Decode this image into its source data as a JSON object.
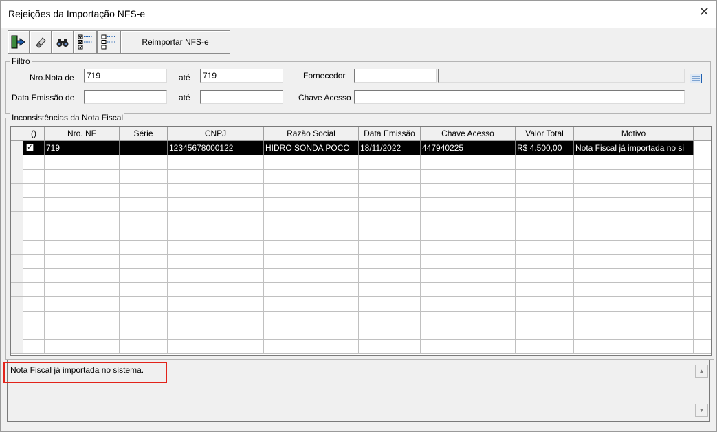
{
  "window": {
    "title": "Rejeições da Importação NFS-e",
    "close_glyph": "✕"
  },
  "toolbar": {
    "reimport_label": "Reimportar NFS-e"
  },
  "filter": {
    "legend": "Filtro",
    "nro_nota_de_label": "Nro.Nota de",
    "nro_nota_de_value": "719",
    "ate1_label": "até",
    "ate1_value": "719",
    "fornecedor_label": "Fornecedor",
    "fornecedor_code": "",
    "fornecedor_name": "",
    "data_emissao_label": "Data Emissão de",
    "data_emissao_de": "",
    "ate2_label": "até",
    "data_emissao_ate": "",
    "chave_acesso_label": "Chave Acesso",
    "chave_acesso_value": ""
  },
  "inconsistencias": {
    "legend": "Inconsistências da Nota Fiscal",
    "headers": [
      "()",
      "Nro. NF",
      "Série",
      "CNPJ",
      "Razão Social",
      "Data Emissão",
      "Chave Acesso",
      "Valor Total",
      "Motivo"
    ],
    "rows": [
      {
        "checked": "✓",
        "nro_nf": "719",
        "serie": "",
        "cnpj": "12345678000122",
        "razao_social": "HIDRO SONDA POCO",
        "data_emissao": "18/11/2022",
        "chave_acesso": "447940225",
        "valor_total": "R$ 4.500,00",
        "motivo": "Nota Fiscal já importada no si"
      }
    ]
  },
  "detail": {
    "message": "Nota Fiscal já importada no sistema.",
    "scroll_up_glyph": "▲",
    "scroll_down_glyph": "▼"
  },
  "colors": {
    "selected_row_bg": "#000000",
    "highlight_border": "#e2231a"
  }
}
